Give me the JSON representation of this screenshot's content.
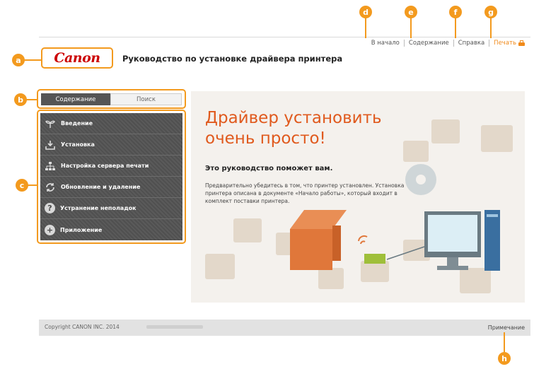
{
  "top_nav": {
    "home": "В начало",
    "contents": "Содержание",
    "help": "Справка",
    "print": "Печать"
  },
  "logo": "Canon",
  "title": "Руководство по установке драйвера принтера",
  "tabs": {
    "contents": "Содержание",
    "search": "Поиск"
  },
  "menu": [
    {
      "label": "Введение",
      "icon": "sprout-icon"
    },
    {
      "label": "Установка",
      "icon": "install-icon"
    },
    {
      "label": "Настройка сервера печати",
      "icon": "network-icon"
    },
    {
      "label": "Обновление и удаление",
      "icon": "refresh-icon"
    },
    {
      "label": "Устранение неполадок",
      "icon": "help-icon"
    },
    {
      "label": "Приложение",
      "icon": "plus-icon"
    }
  ],
  "hero": {
    "title_line1": "Драйвер установить",
    "title_line2": "очень просто!",
    "subtitle": "Это руководство поможет вам.",
    "text": "Предварительно убедитесь в том, что принтер установлен. Установка принтера описана в документе «Начало работы», который входит в комплект поставки принтера."
  },
  "footer": {
    "copyright": "Copyright CANON INC. 2014",
    "notice": "Примечание"
  },
  "callouts": [
    "a",
    "b",
    "c",
    "d",
    "e",
    "f",
    "g",
    "h"
  ],
  "colors": {
    "accent": "#f39a1e",
    "brand": "#cc0000",
    "hero_title": "#e05a1e"
  }
}
